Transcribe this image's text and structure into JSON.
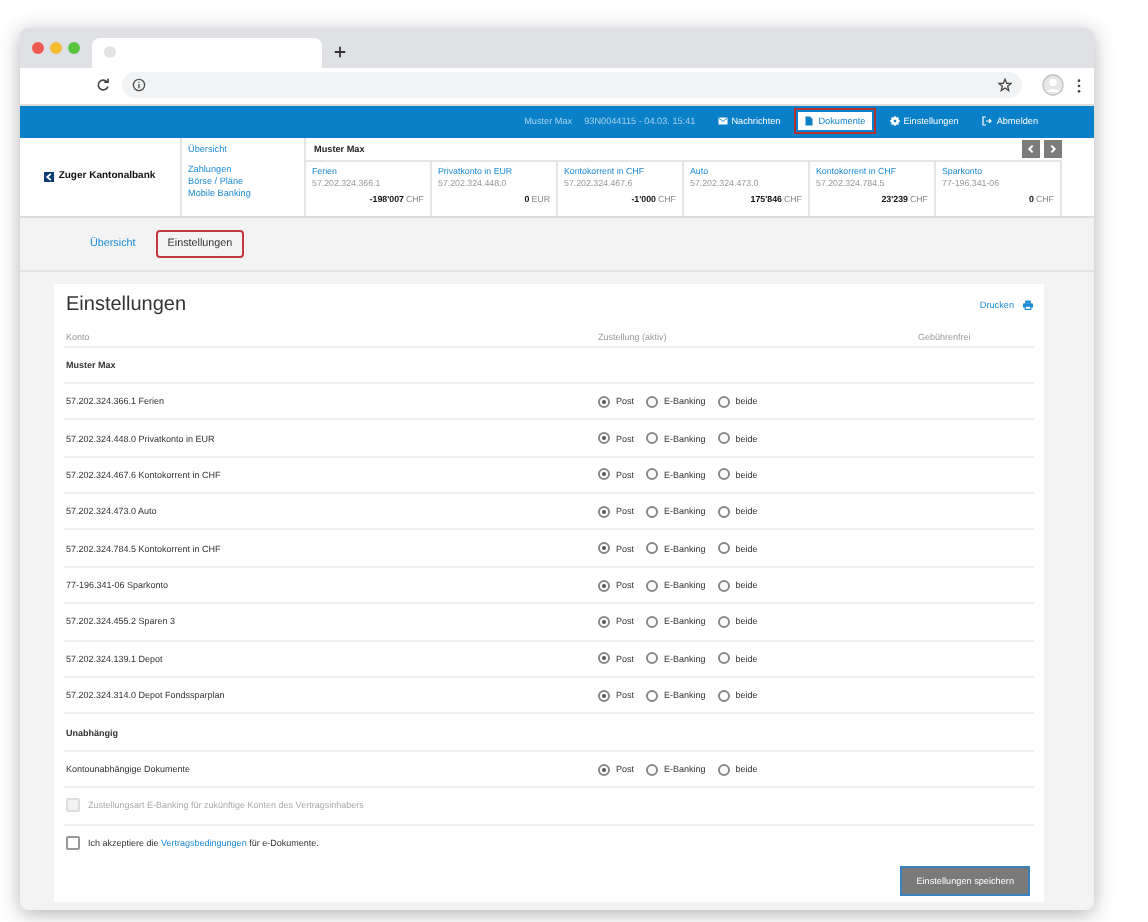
{
  "topbar": {
    "user": "Muster Max",
    "session": "93N0044115 - 04.03. 15:41",
    "links": [
      {
        "label": "Nachrichten",
        "kind": "mail",
        "selected": false
      },
      {
        "label": "Dokumente",
        "kind": "doc",
        "selected": true
      },
      {
        "label": "Einstellungen",
        "kind": "gear",
        "selected": false
      },
      {
        "label": "Abmelden",
        "kind": "logout",
        "selected": false
      }
    ]
  },
  "bank": {
    "logo": "Zuger Kantonalbank",
    "nav": [
      "Übersicht",
      "Zahlungen",
      "Börse / Pläne",
      "Mobile Banking"
    ],
    "owner": "Muster Max",
    "accounts": [
      {
        "name": "Ferien",
        "number": "57.202.324.366.1",
        "balance": "-198'007",
        "currency": "CHF"
      },
      {
        "name": "Privatkonto in EUR",
        "number": "57.202.324.448.0",
        "balance": "0",
        "currency": "EUR"
      },
      {
        "name": "Kontokorrent in CHF",
        "number": "57.202.324.467.6",
        "balance": "-1'000",
        "currency": "CHF"
      },
      {
        "name": "Auto",
        "number": "57.202.324.473.0",
        "balance": "175'846",
        "currency": "CHF"
      },
      {
        "name": "Kontokorrent in CHF",
        "number": "57.202.324.784.5",
        "balance": "23'239",
        "currency": "CHF"
      },
      {
        "name": "Sparkonto",
        "number": "77-196.341-06",
        "balance": "0",
        "currency": "CHF"
      }
    ]
  },
  "subtabs": [
    {
      "label": "Übersicht",
      "selected": false
    },
    {
      "label": "Einstellungen",
      "selected": true
    }
  ],
  "settings": {
    "title": "Einstellungen",
    "print": "Drucken",
    "columns": [
      "Konto",
      "Zustellung (aktiv)",
      "Gebührenfrei"
    ],
    "groups": [
      {
        "title": "Muster Max",
        "rows": [
          {
            "label": "57.202.324.366.1 Ferien",
            "options": [
              {
                "label": "Post",
                "selected": true
              },
              {
                "label": "E-Banking",
                "selected": false
              },
              {
                "label": "beide",
                "selected": false
              }
            ]
          },
          {
            "label": "57.202.324.448.0 Privatkonto in EUR",
            "options": [
              {
                "label": "Post",
                "selected": true
              },
              {
                "label": "E-Banking",
                "selected": false
              },
              {
                "label": "beide",
                "selected": false
              }
            ]
          },
          {
            "label": "57.202.324.467.6 Kontokorrent in CHF",
            "options": [
              {
                "label": "Post",
                "selected": true
              },
              {
                "label": "E-Banking",
                "selected": false
              },
              {
                "label": "beide",
                "selected": false
              }
            ]
          },
          {
            "label": "57.202.324.473.0 Auto",
            "options": [
              {
                "label": "Post",
                "selected": true
              },
              {
                "label": "E-Banking",
                "selected": false
              },
              {
                "label": "beide",
                "selected": false
              }
            ]
          },
          {
            "label": "57.202.324.784.5 Kontokorrent in CHF",
            "options": [
              {
                "label": "Post",
                "selected": true
              },
              {
                "label": "E-Banking",
                "selected": false
              },
              {
                "label": "beide",
                "selected": false
              }
            ]
          },
          {
            "label": "77-196.341-06 Sparkonto",
            "options": [
              {
                "label": "Post",
                "selected": true
              },
              {
                "label": "E-Banking",
                "selected": false
              },
              {
                "label": "beide",
                "selected": false
              }
            ]
          },
          {
            "label": "57.202.324.455.2 Sparen 3",
            "options": [
              {
                "label": "Post",
                "selected": true
              },
              {
                "label": "E-Banking",
                "selected": false
              },
              {
                "label": "beide",
                "selected": false
              }
            ]
          },
          {
            "label": "57.202.324.139.1 Depot",
            "options": [
              {
                "label": "Post",
                "selected": true
              },
              {
                "label": "E-Banking",
                "selected": false
              },
              {
                "label": "beide",
                "selected": false
              }
            ]
          },
          {
            "label": "57.202.324.314.0 Depot Fondssparplan",
            "options": [
              {
                "label": "Post",
                "selected": true
              },
              {
                "label": "E-Banking",
                "selected": false
              },
              {
                "label": "beide",
                "selected": false
              }
            ]
          }
        ]
      },
      {
        "title": "Unabhängig",
        "rows": [
          {
            "label": "Kontounabhängige Dokumente",
            "options": [
              {
                "label": "Post",
                "selected": true
              },
              {
                "label": "E-Banking",
                "selected": false
              },
              {
                "label": "beide",
                "selected": false
              }
            ]
          }
        ]
      }
    ],
    "future": {
      "label": "Zustellungsart E-Banking für zukünftige Konten des Vertragsinhabers",
      "checked": false,
      "disabled": true
    },
    "terms": {
      "before": "Ich akzeptiere die ",
      "link": "Vertragsbedingungen",
      "after": " für e-Dokumente.",
      "checked": false
    },
    "save": "Einstellungen speichern"
  }
}
